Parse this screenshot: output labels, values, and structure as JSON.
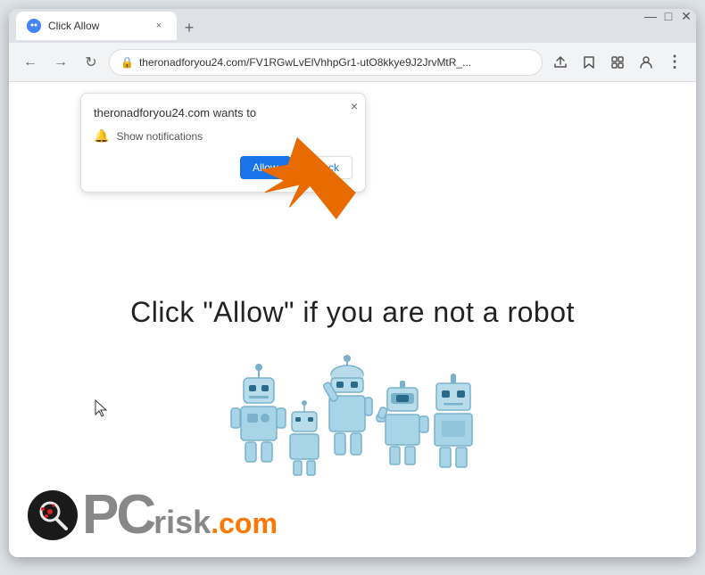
{
  "browser": {
    "tab": {
      "label": "Click Allow",
      "favicon": "◉"
    },
    "new_tab_label": "+",
    "nav": {
      "back": "←",
      "forward": "→",
      "refresh": "↻"
    },
    "address": {
      "url": "theronadforyou24.com/FV1RGwLvElVhhpGr1-utO8kkye9J2JrvMtR_...",
      "lock": "🔒"
    },
    "toolbar_icons": {
      "share": "↑",
      "bookmark": "☆",
      "extensions": "◫",
      "profile": "👤",
      "menu": "⋮"
    },
    "window_controls": {
      "minimize": "—",
      "maximize": "□",
      "close": "✕"
    }
  },
  "notification_popup": {
    "domain": "theronadforyou24.com wants to",
    "notification_label": "Show notifications",
    "allow_label": "Allow",
    "block_label": "Block",
    "close_label": "×"
  },
  "page": {
    "main_text": "Click \"Allow\"   if you are not   a robot"
  },
  "pcrisk": {
    "pc": "PC",
    "risk": "risk",
    "dot_com": ".com"
  }
}
